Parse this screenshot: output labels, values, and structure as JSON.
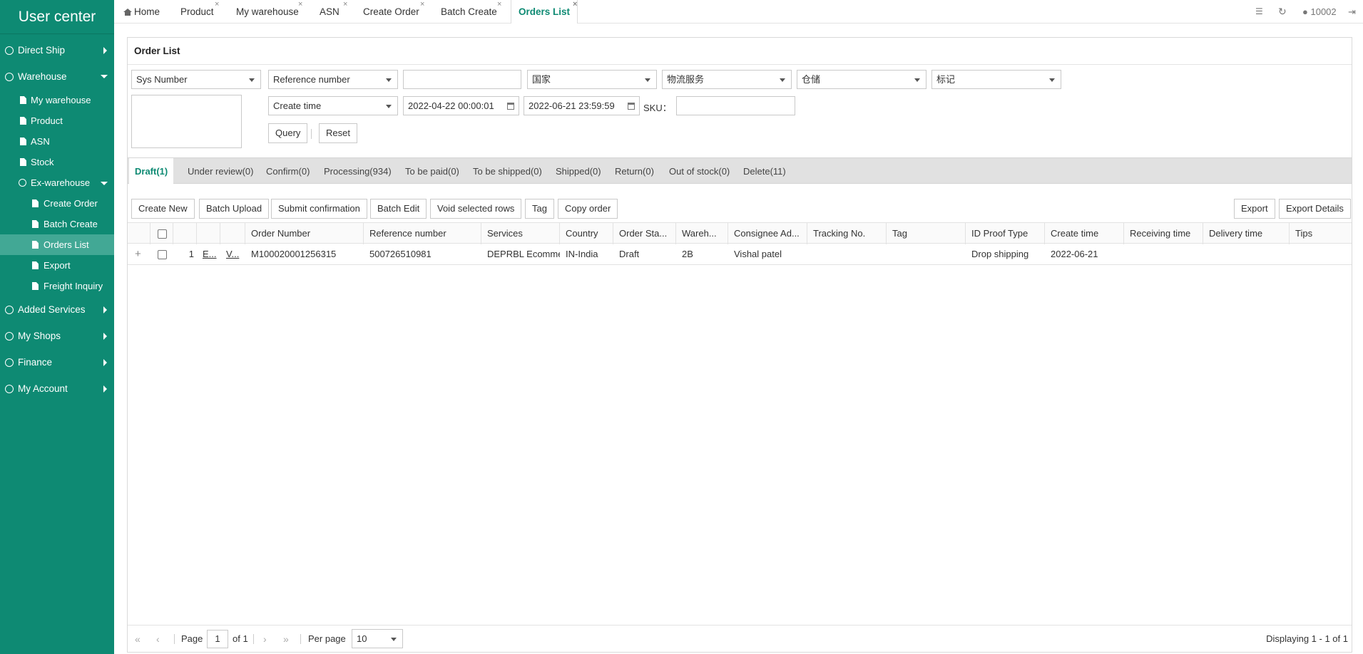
{
  "app": {
    "title": "User center"
  },
  "sidebar": {
    "direct_ship": "Direct Ship",
    "warehouse": "Warehouse",
    "my_warehouse": "My warehouse",
    "product": "Product",
    "asn": "ASN",
    "stock": "Stock",
    "ex_warehouse": "Ex-warehouse",
    "create_order": "Create Order",
    "batch_create": "Batch Create",
    "orders_list": "Orders List",
    "export": "Export",
    "freight_inquiry": "Freight Inquiry",
    "added_services": "Added Services",
    "my_shops": "My Shops",
    "finance": "Finance",
    "my_account": "My Account"
  },
  "tabs": {
    "home": "Home",
    "product": "Product",
    "my_warehouse": "My warehouse",
    "asn": "ASN",
    "create_order": "Create Order",
    "batch_create": "Batch Create",
    "orders_list": "Orders List",
    "close": "×"
  },
  "user": {
    "id": "10002"
  },
  "panel": {
    "title": "Order List"
  },
  "filters": {
    "sys_number": "Sys Number",
    "reference_number": "Reference number",
    "country": "国家",
    "logistics": "物流服务",
    "warehouse": "仓储",
    "mark": "标记",
    "time_type": "Create time",
    "date_from": "2022-04-22 00:00:01",
    "date_to": "2022-06-21 23:59:59",
    "sku_label": "SKU：",
    "query": "Query",
    "reset": "Reset"
  },
  "status_tabs": {
    "draft": "Draft(1)",
    "under_review": "Under review(0)",
    "confirm": "Confirm(0)",
    "processing": "Processing(934)",
    "to_be_paid": "To be paid(0)",
    "to_be_shipped": "To be shipped(0)",
    "shipped": "Shipped(0)",
    "return": "Return(0)",
    "out_of_stock": "Out of stock(0)",
    "delete": "Delete(11)"
  },
  "toolbar": {
    "create_new": "Create New",
    "batch_upload": "Batch Upload",
    "submit_confirmation": "Submit confirmation",
    "batch_edit": "Batch Edit",
    "void_selected": "Void selected rows",
    "tag": "Tag",
    "copy_order": "Copy order",
    "export": "Export",
    "export_details": "Export Details"
  },
  "columns": {
    "order_number": "Order Number",
    "reference_number": "Reference number",
    "services": "Services",
    "country": "Country",
    "order_status": "Order Sta...",
    "warehouse": "Wareh...",
    "consignee": "Consignee Ad...",
    "tracking": "Tracking No.",
    "tag": "Tag",
    "id_proof": "ID Proof Type",
    "create_time": "Create time",
    "receiving_time": "Receiving time",
    "delivery_time": "Delivery time",
    "tips": "Tips"
  },
  "rows": [
    {
      "expand": "+",
      "index": "1",
      "edit": "E...",
      "view": "V...",
      "order_number": "M100020001256315",
      "reference_number": "500726510981",
      "services": "DEPRBL Ecomme",
      "country": "IN-India",
      "order_status": "Draft",
      "warehouse": "2B",
      "consignee": "Vishal patel",
      "tracking": "",
      "tag": "",
      "id_proof": "Drop shipping",
      "create_time": "2022-06-21",
      "receiving_time": "",
      "delivery_time": "",
      "tips": ""
    }
  ],
  "pager": {
    "first": "«",
    "prev": "‹",
    "page_label": "Page",
    "page": "1",
    "of_pages": "of 1",
    "next": "›",
    "last": "»",
    "per_page_label": "Per page",
    "per_page": "10",
    "displaying": "Displaying 1 - 1 of 1"
  }
}
